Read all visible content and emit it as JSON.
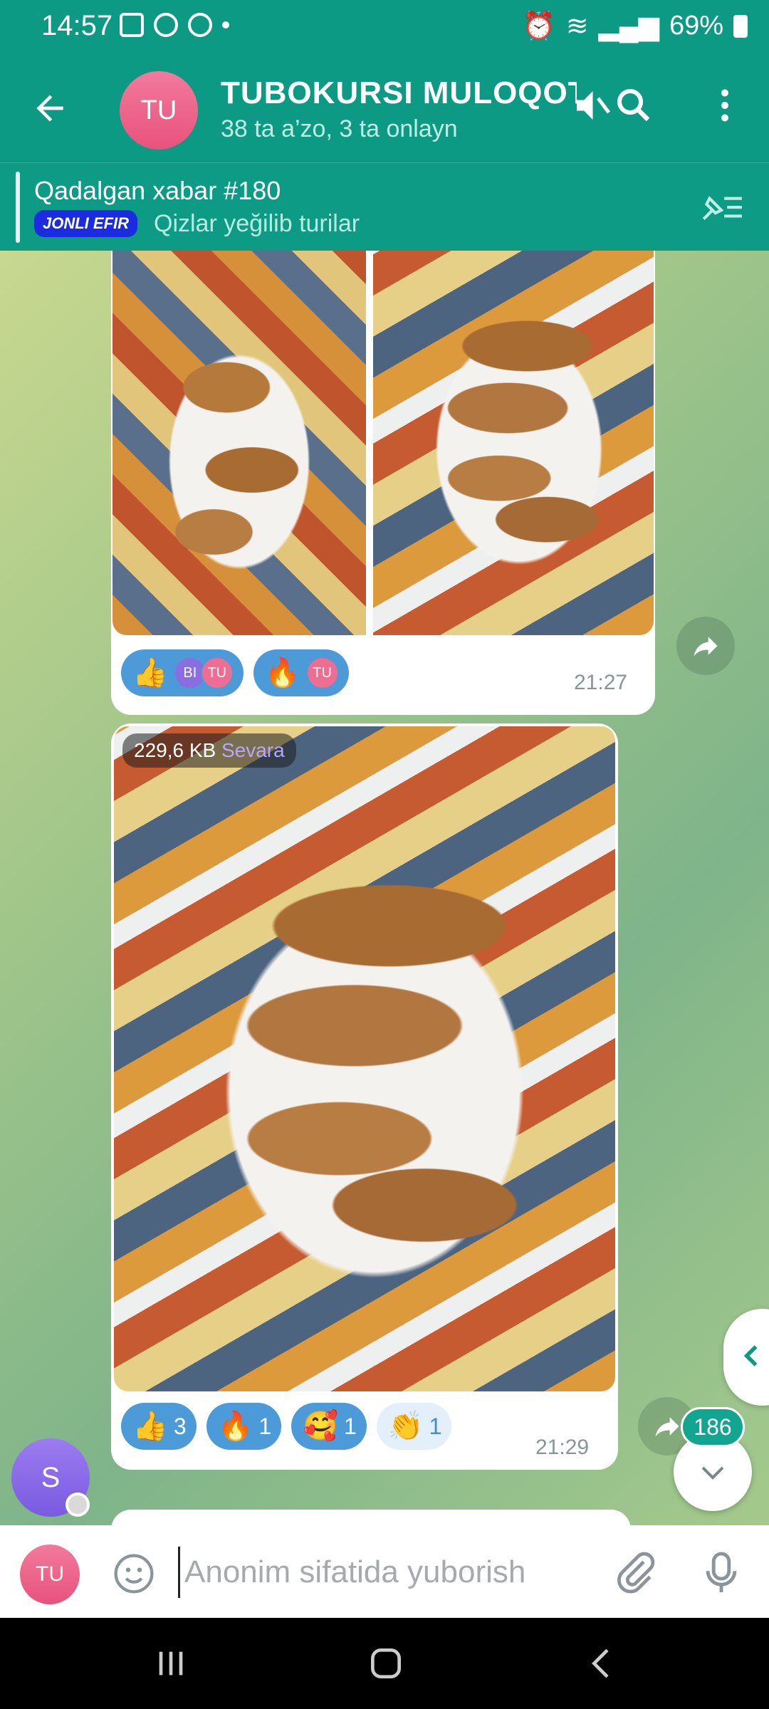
{
  "status": {
    "time": "14:57",
    "battery": "69%"
  },
  "header": {
    "avatar_initials": "TU",
    "title": "TUBOKURSI MULOQOT",
    "subtitle": "38 ta a’zo, 3 ta onlayn"
  },
  "pinned": {
    "title": "Qadalgan xabar #180",
    "badge": "JONLI EFIR",
    "text": "Qizlar yeğilib turilar"
  },
  "messages": [
    {
      "time": "21:27",
      "reactions": [
        {
          "emoji": "👍",
          "avatars": [
            "BI",
            "TU"
          ]
        },
        {
          "emoji": "🔥",
          "avatars": [
            "TU"
          ]
        }
      ]
    },
    {
      "file_size": "229,6 KB",
      "sender": "Sevara",
      "time": "21:29",
      "reactions": [
        {
          "emoji": "👍",
          "count": "3"
        },
        {
          "emoji": "🔥",
          "count": "1"
        },
        {
          "emoji": "🥰",
          "count": "1"
        },
        {
          "emoji": "👏",
          "count": "1"
        }
      ]
    }
  ],
  "side_avatar": "S",
  "unread_count": "186",
  "input": {
    "avatar_initials": "TU",
    "placeholder": "Anonim sifatida yuborish"
  },
  "colors": {
    "header": "#0d9a85",
    "reaction_selected": "#4c9bd8",
    "reaction_unselected": "#e3f0fb"
  }
}
